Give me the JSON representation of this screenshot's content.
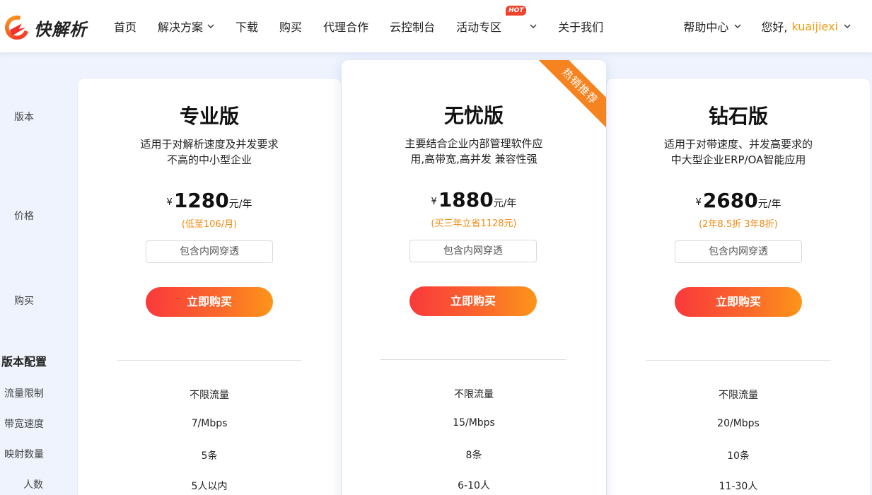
{
  "brand": {
    "name": "快解析"
  },
  "nav": {
    "items": [
      {
        "label": "首页",
        "dropdown": false
      },
      {
        "label": "解决方案",
        "dropdown": true
      },
      {
        "label": "下载",
        "dropdown": false
      },
      {
        "label": "购买",
        "dropdown": false
      },
      {
        "label": "代理合作",
        "dropdown": false
      },
      {
        "label": "云控制台",
        "dropdown": false
      },
      {
        "label": "活动专区",
        "dropdown": true,
        "badge": "HOT"
      },
      {
        "label": "关于我们",
        "dropdown": false
      }
    ],
    "help": "帮助中心",
    "greeting": "您好,",
    "username": "kuaijiexi"
  },
  "side": {
    "version": "版本",
    "price": "价格",
    "buy": "购买",
    "config": "版本配置",
    "traffic": "流量限制",
    "bandwidth": "带宽速度",
    "mapping": "映射数量",
    "users": "人数"
  },
  "plans": [
    {
      "title": "专业版",
      "desc1": "适用于对解析速度及并发要求",
      "desc2": "不高的中小型企业",
      "currency": "¥",
      "price": "1280",
      "unit": "元/年",
      "note": "(低至106/月)",
      "include": "包含内网穿透",
      "buy": "立即购买",
      "traffic": "不限流量",
      "bandwidth": "7/Mbps",
      "mapping": "5条",
      "users": "5人以内"
    },
    {
      "title": "无忧版",
      "desc1": "主要结合企业内部管理软件应",
      "desc2": "用,高带宽,高并发 兼容性强",
      "currency": "¥",
      "price": "1880",
      "unit": "元/年",
      "note": "(买三年立省1128元)",
      "include": "包含内网穿透",
      "buy": "立即购买",
      "traffic": "不限流量",
      "bandwidth": "15/Mbps",
      "mapping": "8条",
      "users": "6-10人",
      "ribbon": "热销推荐"
    },
    {
      "title": "钻石版",
      "desc1": "适用于对带速度、并发高要求的",
      "desc2": "中大型企业ERP/OA智能应用",
      "currency": "¥",
      "price": "2680",
      "unit": "元/年",
      "note": "(2年8.5折 3年8折)",
      "include": "包含内网穿透",
      "buy": "立即购买",
      "traffic": "不限流量",
      "bandwidth": "20/Mbps",
      "mapping": "10条",
      "users": "11-30人"
    }
  ],
  "colors": {
    "accent": "#f5831f",
    "primary_gradient_start": "#f9393b",
    "primary_gradient_end": "#fd9519",
    "note": "#f08a12"
  }
}
